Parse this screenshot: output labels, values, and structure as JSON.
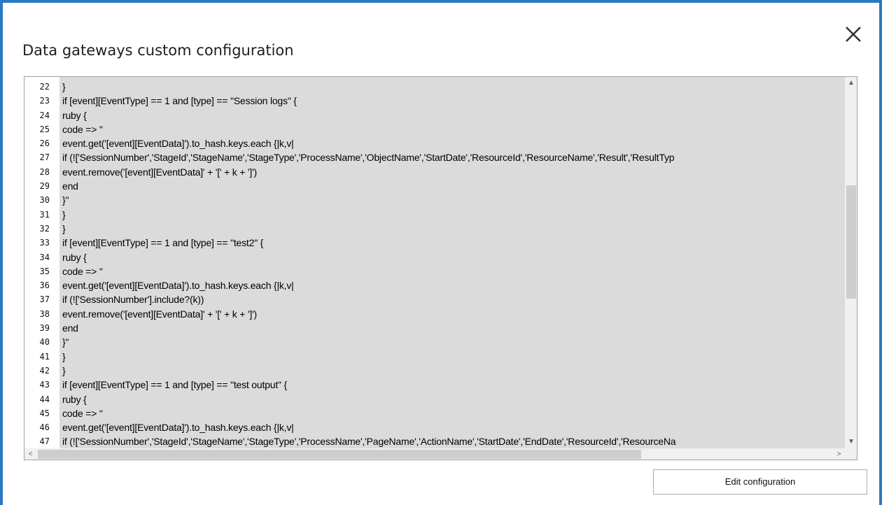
{
  "dialog": {
    "title": "Data gateways custom configuration",
    "close_icon": "close-icon",
    "edit_button_label": "Edit configuration"
  },
  "editor": {
    "background_color": "#dbdbdb",
    "lines": [
      {
        "n": "22",
        "text": "}"
      },
      {
        "n": "23",
        "text": "if [event][EventType] == 1 and [type] == \"Session logs\" {"
      },
      {
        "n": "24",
        "text": "ruby {"
      },
      {
        "n": "25",
        "text": "code => \""
      },
      {
        "n": "26",
        "text": "event.get('[event][EventData]').to_hash.keys.each {|k,v|"
      },
      {
        "n": "27",
        "text": "if (!['SessionNumber','StageId','StageName','StageType','ProcessName','ObjectName','StartDate','ResourceId','ResourceName','Result','ResultTyp"
      },
      {
        "n": "28",
        "text": "event.remove('[event][EventData]' + '[' + k + ']')"
      },
      {
        "n": "29",
        "text": "end"
      },
      {
        "n": "30",
        "text": "}\""
      },
      {
        "n": "31",
        "text": "}"
      },
      {
        "n": "32",
        "text": "}"
      },
      {
        "n": "33",
        "text": "if [event][EventType] == 1 and [type] == \"test2\" {"
      },
      {
        "n": "34",
        "text": "ruby {"
      },
      {
        "n": "35",
        "text": "code => \""
      },
      {
        "n": "36",
        "text": "event.get('[event][EventData]').to_hash.keys.each {|k,v|"
      },
      {
        "n": "37",
        "text": "if (!['SessionNumber'].include?(k))"
      },
      {
        "n": "38",
        "text": "event.remove('[event][EventData]' + '[' + k + ']')"
      },
      {
        "n": "39",
        "text": "end"
      },
      {
        "n": "40",
        "text": "}\""
      },
      {
        "n": "41",
        "text": "}"
      },
      {
        "n": "42",
        "text": "}"
      },
      {
        "n": "43",
        "text": "if [event][EventType] == 1 and [type] == \"test output\" {"
      },
      {
        "n": "44",
        "text": "ruby {"
      },
      {
        "n": "45",
        "text": "code => \""
      },
      {
        "n": "46",
        "text": "event.get('[event][EventData]').to_hash.keys.each {|k,v|"
      },
      {
        "n": "47",
        "text": "if (!['SessionNumber','StageId','StageName','StageType','ProcessName','PageName','ActionName','StartDate','EndDate','ResourceId','ResourceNa"
      }
    ]
  },
  "scrollbars": {
    "up_arrow": "▲",
    "down_arrow": "▼",
    "left_arrow": "<",
    "right_arrow": ">"
  }
}
